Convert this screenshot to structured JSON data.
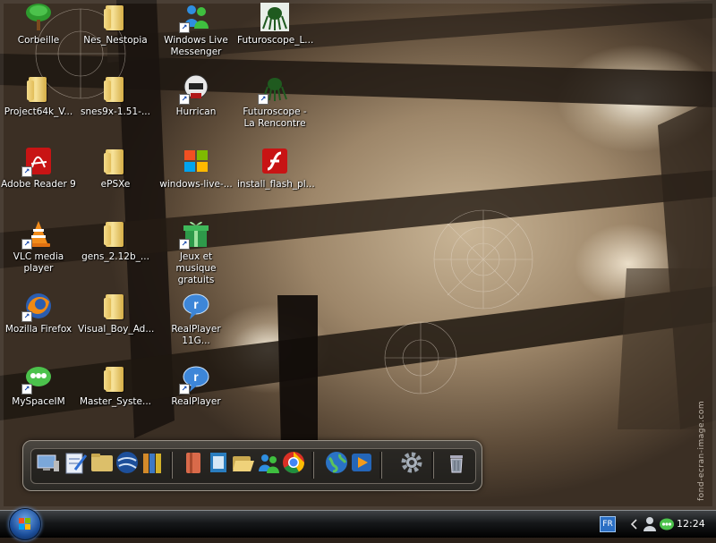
{
  "desktop": {
    "icons": [
      {
        "label": "Corbeille",
        "icon": "recycle-bin-tree-icon",
        "shortcut": false
      },
      {
        "label": "Project64k_V...",
        "icon": "folder-icon",
        "shortcut": false
      },
      {
        "label": "Adobe Reader 9",
        "icon": "adobe-reader-icon",
        "shortcut": true
      },
      {
        "label": "VLC media player",
        "icon": "vlc-cone-icon",
        "shortcut": true
      },
      {
        "label": "Mozilla Firefox",
        "icon": "firefox-icon",
        "shortcut": true
      },
      {
        "label": "MySpaceIM",
        "icon": "myspaceim-icon",
        "shortcut": true
      },
      {
        "label": "Nes_Nestopia",
        "icon": "folder-icon",
        "shortcut": false
      },
      {
        "label": "snes9x-1.51-...",
        "icon": "folder-icon",
        "shortcut": false
      },
      {
        "label": "ePSXe",
        "icon": "folder-icon",
        "shortcut": false
      },
      {
        "label": "gens_2.12b_...",
        "icon": "folder-icon",
        "shortcut": false
      },
      {
        "label": "Visual_Boy_Ad...",
        "icon": "folder-icon",
        "shortcut": false
      },
      {
        "label": "Master_Syste...",
        "icon": "folder-icon",
        "shortcut": false
      },
      {
        "label": "Windows Live Messenger",
        "icon": "messenger-icon",
        "shortcut": true
      },
      {
        "label": "Hurrican",
        "icon": "hurrican-helmet-icon",
        "shortcut": true
      },
      {
        "label": "windows-live-...",
        "icon": "windows-logo-icon",
        "shortcut": false
      },
      {
        "label": "Jeux et musique gratuits",
        "icon": "gift-icon",
        "shortcut": true
      },
      {
        "label": "RealPlayer 11G...",
        "icon": "realplayer-icon",
        "shortcut": false
      },
      {
        "label": "RealPlayer",
        "icon": "realplayer-icon",
        "shortcut": true
      },
      {
        "label": "Futuroscope_L...",
        "icon": "futuroscope-creature-icon",
        "shortcut": false
      },
      {
        "label": "Futuroscope - La Rencontre",
        "icon": "futuroscope-creature-icon",
        "shortcut": true
      },
      {
        "label": "install_flash_pl...",
        "icon": "flash-icon",
        "shortcut": false
      }
    ],
    "watermark": "fond-ecran-image.com"
  },
  "dock": {
    "items": [
      "computer-icon",
      "notes-icon",
      "folder-icon",
      "google-earth-icon",
      "books-icon",
      "binder-icon",
      "document-icon",
      "open-folder-icon",
      "contacts-icon",
      "chrome-icon",
      "globe-icon",
      "media-player-icon",
      "settings-gear-icon",
      "trash-icon"
    ]
  },
  "taskbar": {
    "start_icon": "windows-start-orb-icon",
    "language": "FR",
    "clock": "12:24",
    "tray_icons": [
      "chevron-left-icon",
      "user-icon",
      "myspaceim-tray-icon"
    ]
  }
}
